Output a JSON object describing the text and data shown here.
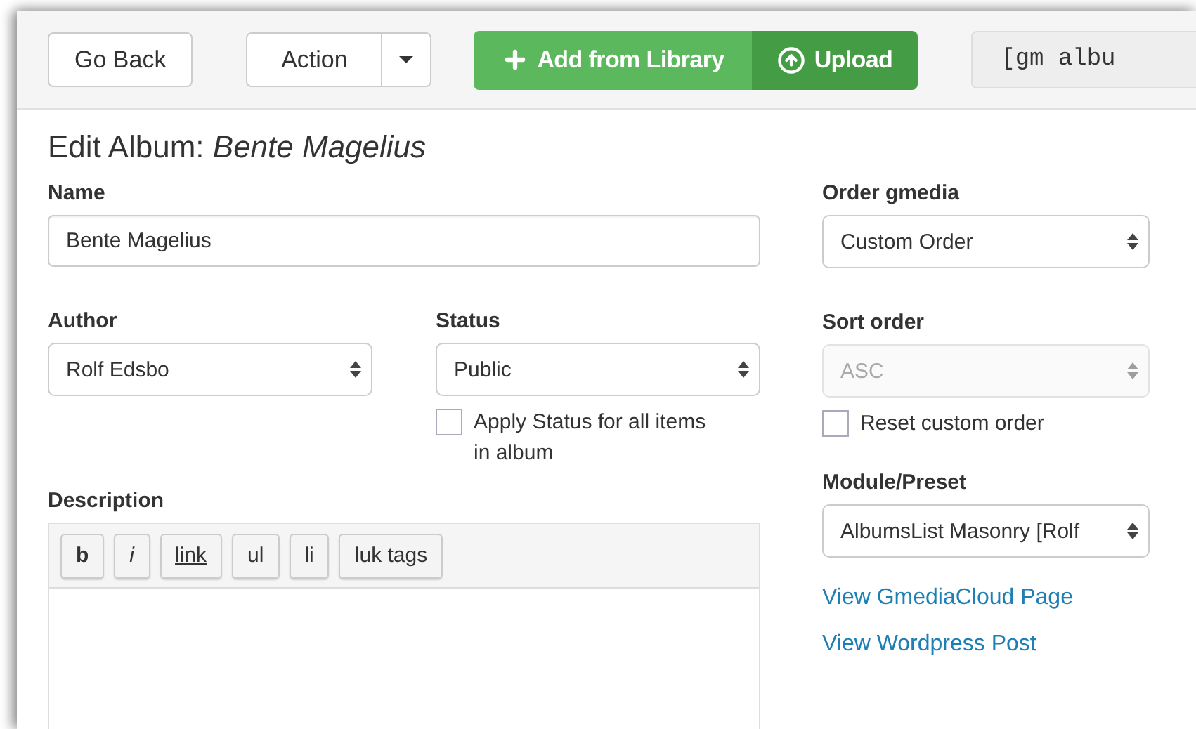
{
  "toolbar": {
    "back_button": "Go Back",
    "action_button": "Action",
    "add_button": "Add from Library",
    "upload_button": "Upload",
    "shortcode": "[gm albu"
  },
  "title": "Edit Album: *Bente Magelius*",
  "name": {
    "label": "Name",
    "value": "Bente Magelius"
  },
  "author": {
    "label": "Author",
    "value": "Rolf Edsbo",
    "disabled": false
  },
  "status": {
    "label": "Status",
    "value": "Public",
    "disabled": false,
    "checkbox": {
      "label": "Apply Status for all items in album",
      "checked": false
    }
  },
  "order_gmedia": {
    "label": "Order gmedia",
    "value": "Custom Order",
    "disabled": false
  },
  "sort_order": {
    "label": "Sort order",
    "value": "ASC",
    "disabled": true,
    "checkbox": {
      "label": "Reset custom order",
      "checked": false
    }
  },
  "module_preset": {
    "label": "Module/Preset",
    "value": "AlbumsList Masonry [Rolf",
    "disabled": false
  },
  "links": [
    "View GmediaCloud Page",
    "View Wordpress Post"
  ],
  "description": {
    "label": "Description",
    "buttons": [
      {
        "label": "b",
        "kind": "bold"
      },
      {
        "label": "i",
        "kind": "italic"
      },
      {
        "label": "link",
        "kind": "link"
      },
      {
        "label": "ul",
        "kind": "plain"
      },
      {
        "label": "li",
        "kind": "plain"
      },
      {
        "label": "luk tags",
        "kind": "plain"
      }
    ]
  }
}
